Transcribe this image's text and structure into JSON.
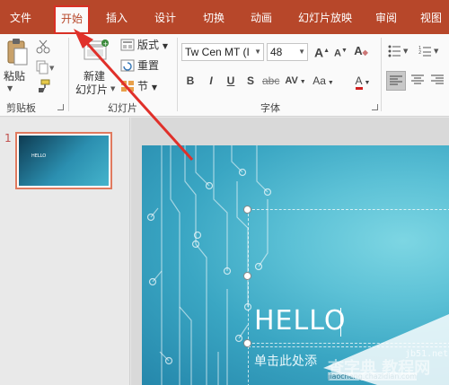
{
  "tabs": [
    {
      "label": "文件"
    },
    {
      "label": "开始"
    },
    {
      "label": "插入"
    },
    {
      "label": "设计"
    },
    {
      "label": "切换"
    },
    {
      "label": "动画"
    },
    {
      "label": "幻灯片放映"
    },
    {
      "label": "审阅"
    },
    {
      "label": "视图"
    }
  ],
  "ribbon": {
    "clipboard": {
      "paste_label": "粘贴",
      "group_label": "剪贴板"
    },
    "slides": {
      "new_slide_label_1": "新建",
      "new_slide_label_2": "幻灯片",
      "layout_label": "版式",
      "reset_label": "重置",
      "section_label": "节",
      "group_label": "幻灯片"
    },
    "font": {
      "font_name": "Tw Cen MT (I",
      "font_size": "48",
      "bold": "B",
      "italic": "I",
      "underline": "U",
      "strike": "S",
      "spacing": "AV",
      "case": "Aa",
      "color": "A",
      "grow": "A",
      "shrink": "A",
      "clear": "A",
      "group_label": "字体"
    }
  },
  "thumbnails": [
    {
      "number": "1",
      "title": "HELLO"
    }
  ],
  "slide": {
    "title": "HELLO",
    "subtitle": "单击此处添"
  },
  "watermark": {
    "main": "查字典 教程网",
    "site": "jb51.net",
    "url": "jiaocheng.chazidian.com"
  },
  "colors": {
    "accent": "#b7472a",
    "annotation": "#d93025",
    "slide_bg": "#3aa6c3"
  },
  "annotation": {
    "target": "开始 tab"
  }
}
